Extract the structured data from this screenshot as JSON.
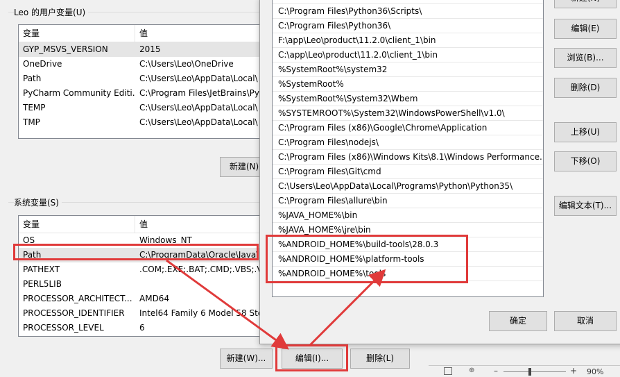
{
  "user_vars": {
    "title": "Leo 的用户变量(U)",
    "headers": {
      "name": "变量",
      "value": "值"
    },
    "rows": [
      {
        "name": "GYP_MSVS_VERSION",
        "value": "2015"
      },
      {
        "name": "OneDrive",
        "value": "C:\\Users\\Leo\\OneDrive"
      },
      {
        "name": "Path",
        "value": "C:\\Users\\Leo\\AppData\\Local\\"
      },
      {
        "name": "PyCharm Community Editi...",
        "value": "C:\\Program Files\\JetBrains\\Py"
      },
      {
        "name": "TEMP",
        "value": "C:\\Users\\Leo\\AppData\\Local\\"
      },
      {
        "name": "TMP",
        "value": "C:\\Users\\Leo\\AppData\\Local\\"
      }
    ],
    "new_button": "新建(N)"
  },
  "system_vars": {
    "title": "系统变量(S)",
    "headers": {
      "name": "变量",
      "value": "值"
    },
    "rows": [
      {
        "name": "OS",
        "value": "Windows_NT"
      },
      {
        "name": "Path",
        "value": "C:\\ProgramData\\Oracle\\Java\\"
      },
      {
        "name": "PATHEXT",
        "value": ".COM;.EXE;.BAT;.CMD;.VBS;.VE"
      },
      {
        "name": "PERL5LIB",
        "value": ""
      },
      {
        "name": "PROCESSOR_ARCHITECT...",
        "value": "AMD64"
      },
      {
        "name": "PROCESSOR_IDENTIFIER",
        "value": "Intel64 Family 6 Model 58 Ste"
      },
      {
        "name": "PROCESSOR_LEVEL",
        "value": "6"
      }
    ],
    "new_button": "新建(W)...",
    "edit_button": "编辑(I)...",
    "delete_button": "删除(L)"
  },
  "edit_dialog": {
    "paths": [
      "C:\\Program Files\\Python36\\Scripts\\",
      "C:\\Program Files\\Python36\\",
      "F:\\app\\Leo\\product\\11.2.0\\client_1\\bin",
      "C:\\app\\Leo\\product\\11.2.0\\client_1\\bin",
      "%SystemRoot%\\system32",
      "%SystemRoot%",
      "%SystemRoot%\\System32\\Wbem",
      "%SYSTEMROOT%\\System32\\WindowsPowerShell\\v1.0\\",
      "C:\\Program Files (x86)\\Google\\Chrome\\Application",
      "C:\\Program Files\\nodejs\\",
      "C:\\Program Files (x86)\\Windows Kits\\8.1\\Windows Performance...",
      "C:\\Program Files\\Git\\cmd",
      "C:\\Users\\Leo\\AppData\\Local\\Programs\\Python\\Python35\\",
      "C:\\Program Files\\allure\\bin",
      "%JAVA_HOME%\\bin",
      "%JAVA_HOME%\\jre\\bin",
      "%ANDROID_HOME%\\build-tools\\28.0.3",
      "%ANDROID_HOME%\\platform-tools",
      "%ANDROID_HOME%\\tools"
    ],
    "buttons": {
      "new": "新建(N)",
      "edit": "编辑(E)",
      "browse": "浏览(B)...",
      "delete": "删除(D)",
      "move_up": "上移(U)",
      "move_down": "下移(O)",
      "edit_text": "编辑文本(T)...",
      "ok": "确定",
      "cancel": "取消"
    }
  },
  "status_bar": {
    "zoom": "90%"
  },
  "colors": {
    "annotation_red": "#e03a3a",
    "selected_row": "#e5e5e5"
  }
}
